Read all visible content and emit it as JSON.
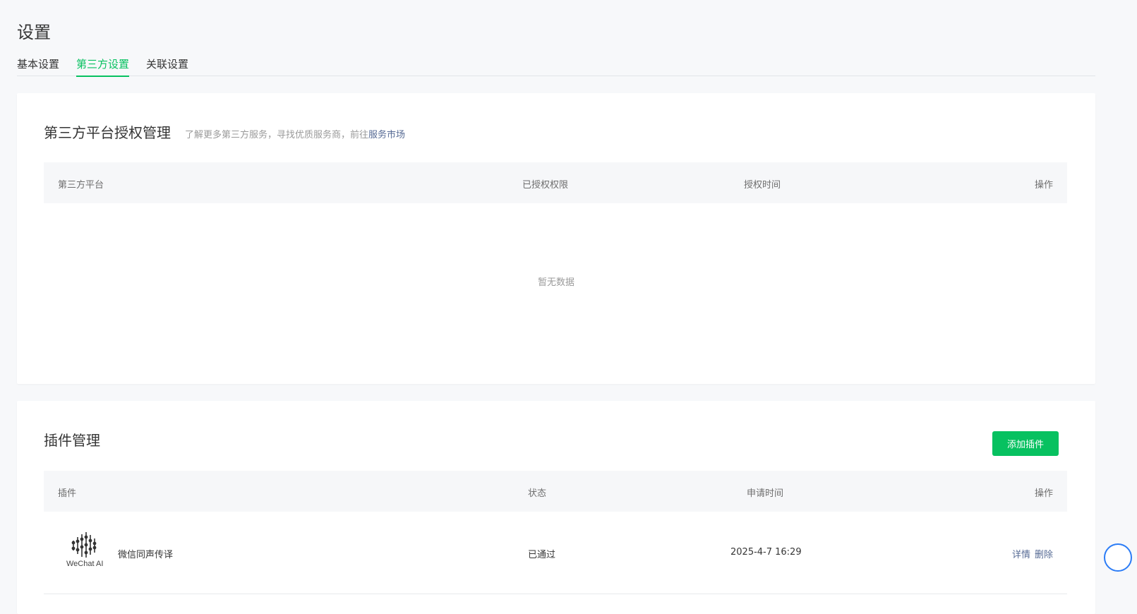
{
  "page": {
    "title": "设置"
  },
  "tabs": [
    {
      "label": "基本设置",
      "active": false
    },
    {
      "label": "第三方设置",
      "active": true
    },
    {
      "label": "关联设置",
      "active": false
    }
  ],
  "thirdparty": {
    "title": "第三方平台授权管理",
    "desc": "了解更多第三方服务，寻找优质服务商，前往",
    "desc_link": "服务市场",
    "columns": [
      "第三方平台",
      "已授权权限",
      "授权时间",
      "操作"
    ],
    "empty_text": "暂无数据"
  },
  "plugins": {
    "title": "插件管理",
    "add_button": "添加插件",
    "columns": [
      "插件",
      "状态",
      "申请时间",
      "操作"
    ],
    "rows": [
      {
        "logo_text": "WeChat AI",
        "name": "微信同声传译",
        "status": "已通过",
        "time": "2025-4-7 16:29",
        "actions": [
          "详情",
          "删除"
        ]
      }
    ]
  },
  "colors": {
    "accent": "#07c160",
    "link": "#576b95"
  }
}
